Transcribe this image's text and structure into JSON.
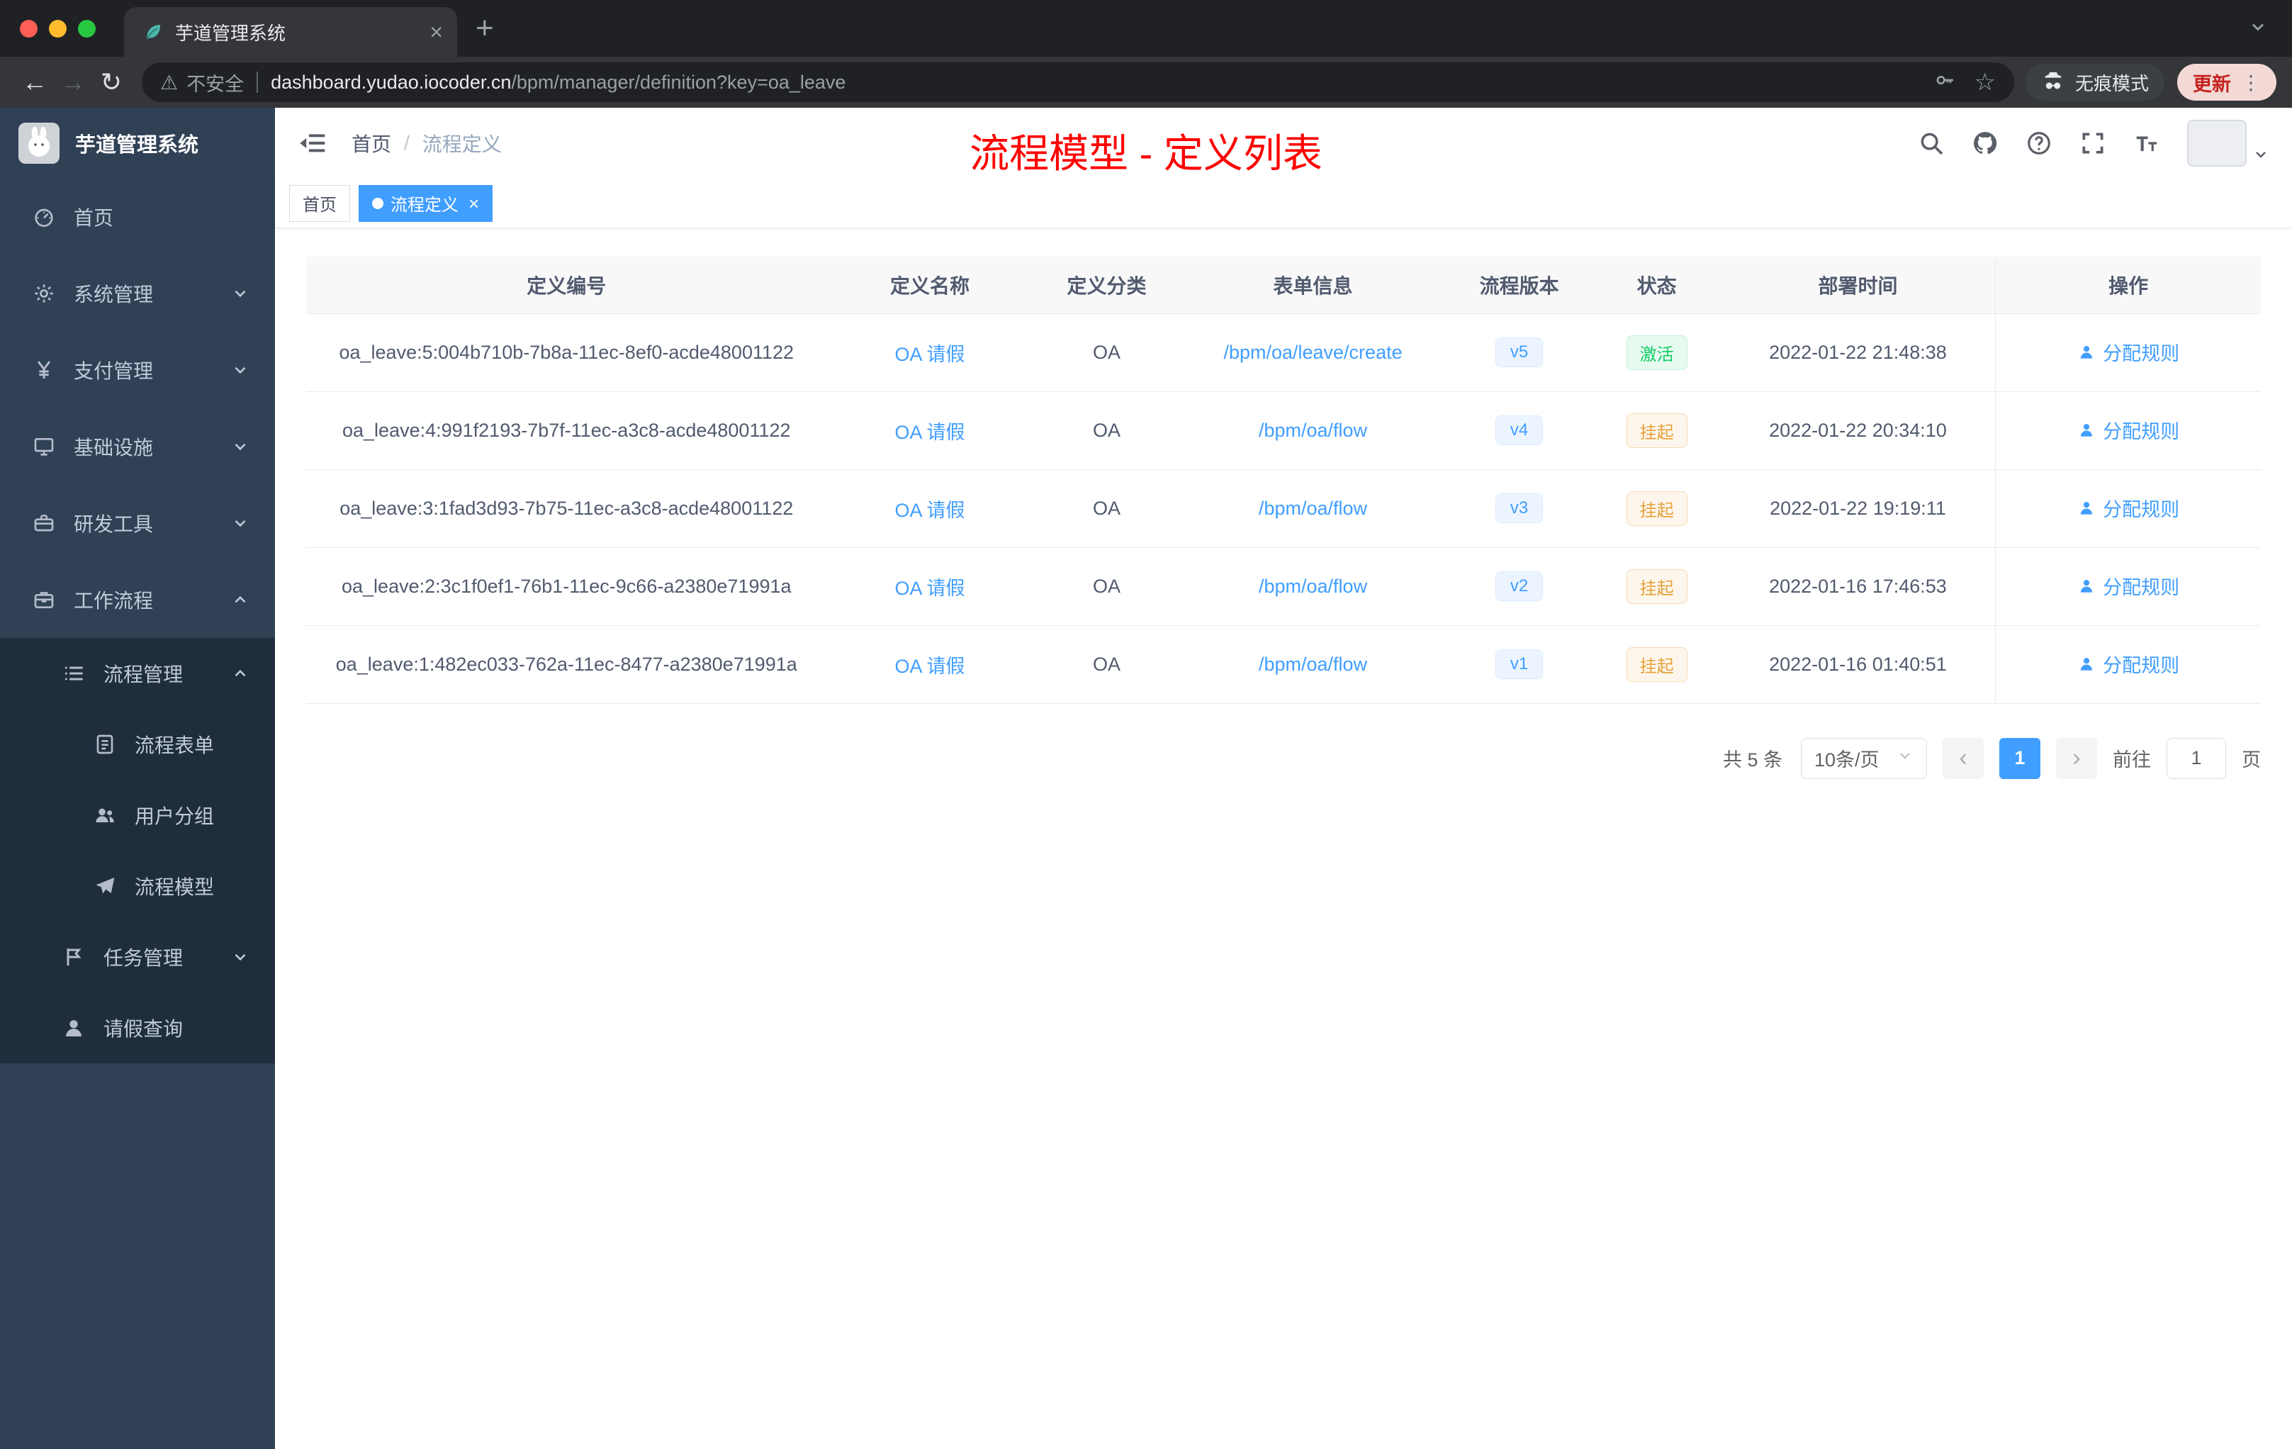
{
  "browser": {
    "tab_title": "芋道管理系统",
    "tab_favicon": "leaf-icon",
    "security_label": "不安全",
    "url_host": "dashboard.yudao.iocoder.cn",
    "url_path": "/bpm/manager/definition?key=oa_leave",
    "incognito_label": "无痕模式",
    "update_label": "更新"
  },
  "sidebar": {
    "logo_title": "芋道管理系统",
    "items": [
      {
        "key": "home",
        "label": "首页",
        "icon": "dashboard-icon",
        "level": 1,
        "sub": false,
        "chevron": null
      },
      {
        "key": "system",
        "label": "系统管理",
        "icon": "gear-icon",
        "level": 1,
        "sub": false,
        "chevron": "down"
      },
      {
        "key": "payment",
        "label": "支付管理",
        "icon": "yen-icon",
        "level": 1,
        "sub": false,
        "chevron": "down"
      },
      {
        "key": "infrastructure",
        "label": "基础设施",
        "icon": "monitor-icon",
        "level": 1,
        "sub": false,
        "chevron": "down"
      },
      {
        "key": "devtools",
        "label": "研发工具",
        "icon": "toolbox-icon",
        "level": 1,
        "sub": false,
        "chevron": "down"
      },
      {
        "key": "workflow",
        "label": "工作流程",
        "icon": "briefcase-icon",
        "level": 1,
        "sub": false,
        "chevron": "up"
      },
      {
        "key": "process-management",
        "label": "流程管理",
        "icon": "list-icon",
        "level": 2,
        "sub": true,
        "chevron": "up"
      },
      {
        "key": "process-form",
        "label": "流程表单",
        "icon": "form-icon",
        "level": 3,
        "sub": true,
        "chevron": null
      },
      {
        "key": "user-group",
        "label": "用户分组",
        "icon": "users-icon",
        "level": 3,
        "sub": true,
        "chevron": null
      },
      {
        "key": "process-model",
        "label": "流程模型",
        "icon": "plane-icon",
        "level": 3,
        "sub": true,
        "chevron": null
      },
      {
        "key": "task-management",
        "label": "任务管理",
        "icon": "flag-icon",
        "level": 2,
        "sub": true,
        "chevron": "down"
      },
      {
        "key": "leave-query",
        "label": "请假查询",
        "icon": "user-icon",
        "level": 2,
        "sub": true,
        "chevron": null
      }
    ]
  },
  "navbar": {
    "breadcrumb": [
      "首页",
      "流程定义"
    ],
    "breadcrumb_separator": "/",
    "annotation": "流程模型 - 定义列表",
    "right_icons": [
      "search-icon",
      "github-icon",
      "help-icon",
      "fullscreen-icon",
      "font-size-icon",
      "avatar"
    ]
  },
  "tags": [
    {
      "label": "首页",
      "active": false,
      "closable": false
    },
    {
      "label": "流程定义",
      "active": true,
      "closable": true
    }
  ],
  "table": {
    "columns": [
      "定义编号",
      "定义名称",
      "定义分类",
      "表单信息",
      "流程版本",
      "状态",
      "部署时间",
      "操作"
    ],
    "rows": [
      {
        "id": "oa_leave:5:004b710b-7b8a-11ec-8ef0-acde48001122",
        "name": "OA 请假",
        "category": "OA",
        "form": "/bpm/oa/leave/create",
        "version": "v5",
        "status": "激活",
        "status_type": "success",
        "time": "2022-01-22 21:48:38",
        "action": "分配规则"
      },
      {
        "id": "oa_leave:4:991f2193-7b7f-11ec-a3c8-acde48001122",
        "name": "OA 请假",
        "category": "OA",
        "form": "/bpm/oa/flow",
        "version": "v4",
        "status": "挂起",
        "status_type": "warning",
        "time": "2022-01-22 20:34:10",
        "action": "分配规则"
      },
      {
        "id": "oa_leave:3:1fad3d93-7b75-11ec-a3c8-acde48001122",
        "name": "OA 请假",
        "category": "OA",
        "form": "/bpm/oa/flow",
        "version": "v3",
        "status": "挂起",
        "status_type": "warning",
        "time": "2022-01-22 19:19:11",
        "action": "分配规则"
      },
      {
        "id": "oa_leave:2:3c1f0ef1-76b1-11ec-9c66-a2380e71991a",
        "name": "OA 请假",
        "category": "OA",
        "form": "/bpm/oa/flow",
        "version": "v2",
        "status": "挂起",
        "status_type": "warning",
        "time": "2022-01-16 17:46:53",
        "action": "分配规则"
      },
      {
        "id": "oa_leave:1:482ec033-762a-11ec-8477-a2380e71991a",
        "name": "OA 请假",
        "category": "OA",
        "form": "/bpm/oa/flow",
        "version": "v1",
        "status": "挂起",
        "status_type": "warning",
        "time": "2022-01-16 01:40:51",
        "action": "分配规则"
      }
    ]
  },
  "pagination": {
    "total": "共 5 条",
    "page_size": "10条/页",
    "active_page": "1",
    "goto_label": "前往",
    "goto_value": "1",
    "page_suffix": "页"
  },
  "colors": {
    "accent": "#409eff",
    "sidebar_bg": "#304156",
    "submenu_bg": "#1f2d3d",
    "success": "#13ce66",
    "warning": "#e6a23c",
    "annotation_red": "#ff0000"
  }
}
